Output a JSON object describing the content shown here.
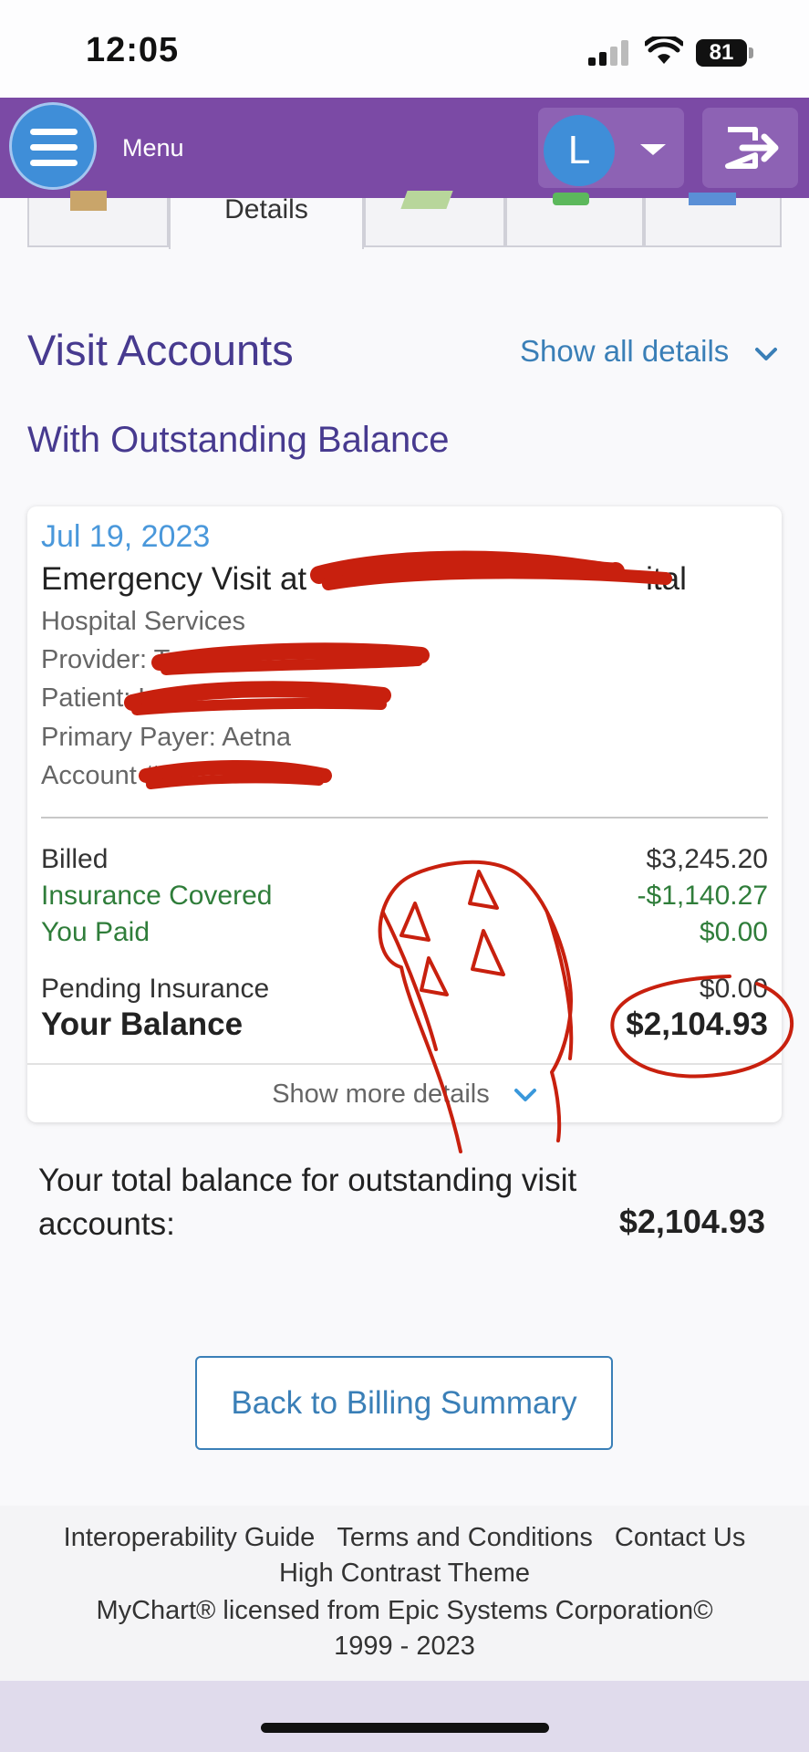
{
  "status_bar": {
    "time": "12:05",
    "battery": "81"
  },
  "header": {
    "menu_label": "Menu",
    "avatar_initial": "L"
  },
  "tabs": [
    {
      "label": ""
    },
    {
      "label": "Details"
    },
    {
      "label": ""
    },
    {
      "label": ""
    },
    {
      "label": ""
    }
  ],
  "page": {
    "title": "Visit Accounts",
    "show_all_label": "Show all details",
    "subtitle": "With Outstanding Balance"
  },
  "visit": {
    "date": "Jul 19, 2023",
    "title": "Emergency Visit at",
    "title_suffix": "ital",
    "service_type": "Hospital Services",
    "provider_label": "Provider: T",
    "patient_label": "Patient: L",
    "payer": "Primary Payer: Aetna",
    "account_label": "Account #"
  },
  "amounts": {
    "billed_label": "Billed",
    "billed_value": "$3,245.20",
    "insurance_covered_label": "Insurance Covered",
    "insurance_covered_value": "-$1,140.27",
    "you_paid_label": "You Paid",
    "you_paid_value": "$0.00",
    "pending_label": "Pending Insurance",
    "pending_value": "$0.00",
    "balance_label": "Your Balance",
    "balance_value": "$2,104.93"
  },
  "show_more_label": "Show more details",
  "total": {
    "label": "Your total balance for outstanding visit accounts:",
    "value": "$2,104.93"
  },
  "back_button_label": "Back to Billing Summary",
  "footer": {
    "links": [
      "Interoperability Guide",
      "Terms and Conditions",
      "Contact Us",
      "High Contrast Theme"
    ],
    "copyright_line1": "MyChart® licensed from Epic Systems Corporation©",
    "copyright_line2": "1999 - 2023"
  },
  "icons": {
    "menu": "hamburger-icon",
    "user_dropdown": "chevron-down-icon",
    "logout": "logout-icon",
    "show_all": "chevron-down-icon",
    "show_more": "chevron-down-icon"
  },
  "colors": {
    "header_bg": "#7b4aa5",
    "accent_blue": "#3a7fb7",
    "heading_purple": "#473a8f",
    "green": "#2f7d3a",
    "redaction_red": "#c8200e"
  }
}
